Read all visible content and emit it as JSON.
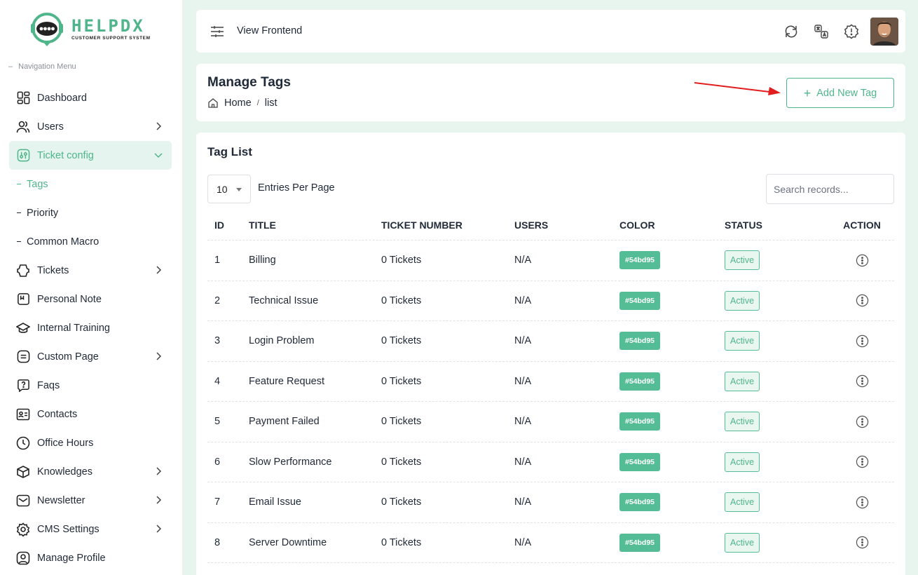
{
  "brand": {
    "title": "HELPDX",
    "subtitle": "CUSTOMER SUPPORT SYSTEM",
    "accent": "#4fb58b"
  },
  "sidebar": {
    "caption": "Navigation Menu",
    "items": [
      {
        "label": "Dashboard",
        "icon": "dashboard-icon"
      },
      {
        "label": "Users",
        "icon": "users-icon",
        "has_children": true
      },
      {
        "label": "Ticket config",
        "icon": "settings-sliders-icon",
        "has_children": true,
        "active": true,
        "children": [
          {
            "label": "Tags",
            "active": true
          },
          {
            "label": "Priority"
          },
          {
            "label": "Common Macro"
          }
        ]
      },
      {
        "label": "Tickets",
        "icon": "ticket-icon",
        "has_children": true
      },
      {
        "label": "Personal Note",
        "icon": "note-icon"
      },
      {
        "label": "Internal Training",
        "icon": "graduation-cap-icon"
      },
      {
        "label": "Custom Page",
        "icon": "page-icon",
        "has_children": true
      },
      {
        "label": "Faqs",
        "icon": "question-icon"
      },
      {
        "label": "Contacts",
        "icon": "contact-card-icon"
      },
      {
        "label": "Office Hours",
        "icon": "clock-icon"
      },
      {
        "label": "Knowledges",
        "icon": "box-icon",
        "has_children": true
      },
      {
        "label": "Newsletter",
        "icon": "mail-icon",
        "has_children": true
      },
      {
        "label": "CMS Settings",
        "icon": "gear-icon",
        "has_children": true
      },
      {
        "label": "Manage Profile",
        "icon": "profile-icon"
      }
    ]
  },
  "topbar": {
    "view_frontend": "View Frontend",
    "icons": [
      "refresh-icon",
      "translate-icon",
      "alert-icon",
      "avatar"
    ]
  },
  "header": {
    "title": "Manage Tags",
    "breadcrumb": [
      "Home",
      "list"
    ],
    "add_button": "Add New Tag"
  },
  "list": {
    "title": "Tag List",
    "entries_value": "10",
    "entries_label": "Entries Per Page",
    "search_placeholder": "Search records...",
    "columns": [
      "ID",
      "TITLE",
      "TICKET NUMBER",
      "USERS",
      "COLOR",
      "STATUS",
      "ACTION"
    ],
    "rows": [
      {
        "id": "1",
        "title": "Billing",
        "tickets": "0 Tickets",
        "users": "N/A",
        "color": "#54bd95",
        "status": "Active"
      },
      {
        "id": "2",
        "title": "Technical Issue",
        "tickets": "0 Tickets",
        "users": "N/A",
        "color": "#54bd95",
        "status": "Active"
      },
      {
        "id": "3",
        "title": "Login Problem",
        "tickets": "0 Tickets",
        "users": "N/A",
        "color": "#54bd95",
        "status": "Active"
      },
      {
        "id": "4",
        "title": "Feature Request",
        "tickets": "0 Tickets",
        "users": "N/A",
        "color": "#54bd95",
        "status": "Active"
      },
      {
        "id": "5",
        "title": "Payment Failed",
        "tickets": "0 Tickets",
        "users": "N/A",
        "color": "#54bd95",
        "status": "Active"
      },
      {
        "id": "6",
        "title": "Slow Performance",
        "tickets": "0 Tickets",
        "users": "N/A",
        "color": "#54bd95",
        "status": "Active"
      },
      {
        "id": "7",
        "title": "Email Issue",
        "tickets": "0 Tickets",
        "users": "N/A",
        "color": "#54bd95",
        "status": "Active"
      },
      {
        "id": "8",
        "title": "Server Downtime",
        "tickets": "0 Tickets",
        "users": "N/A",
        "color": "#54bd95",
        "status": "Active"
      }
    ]
  }
}
